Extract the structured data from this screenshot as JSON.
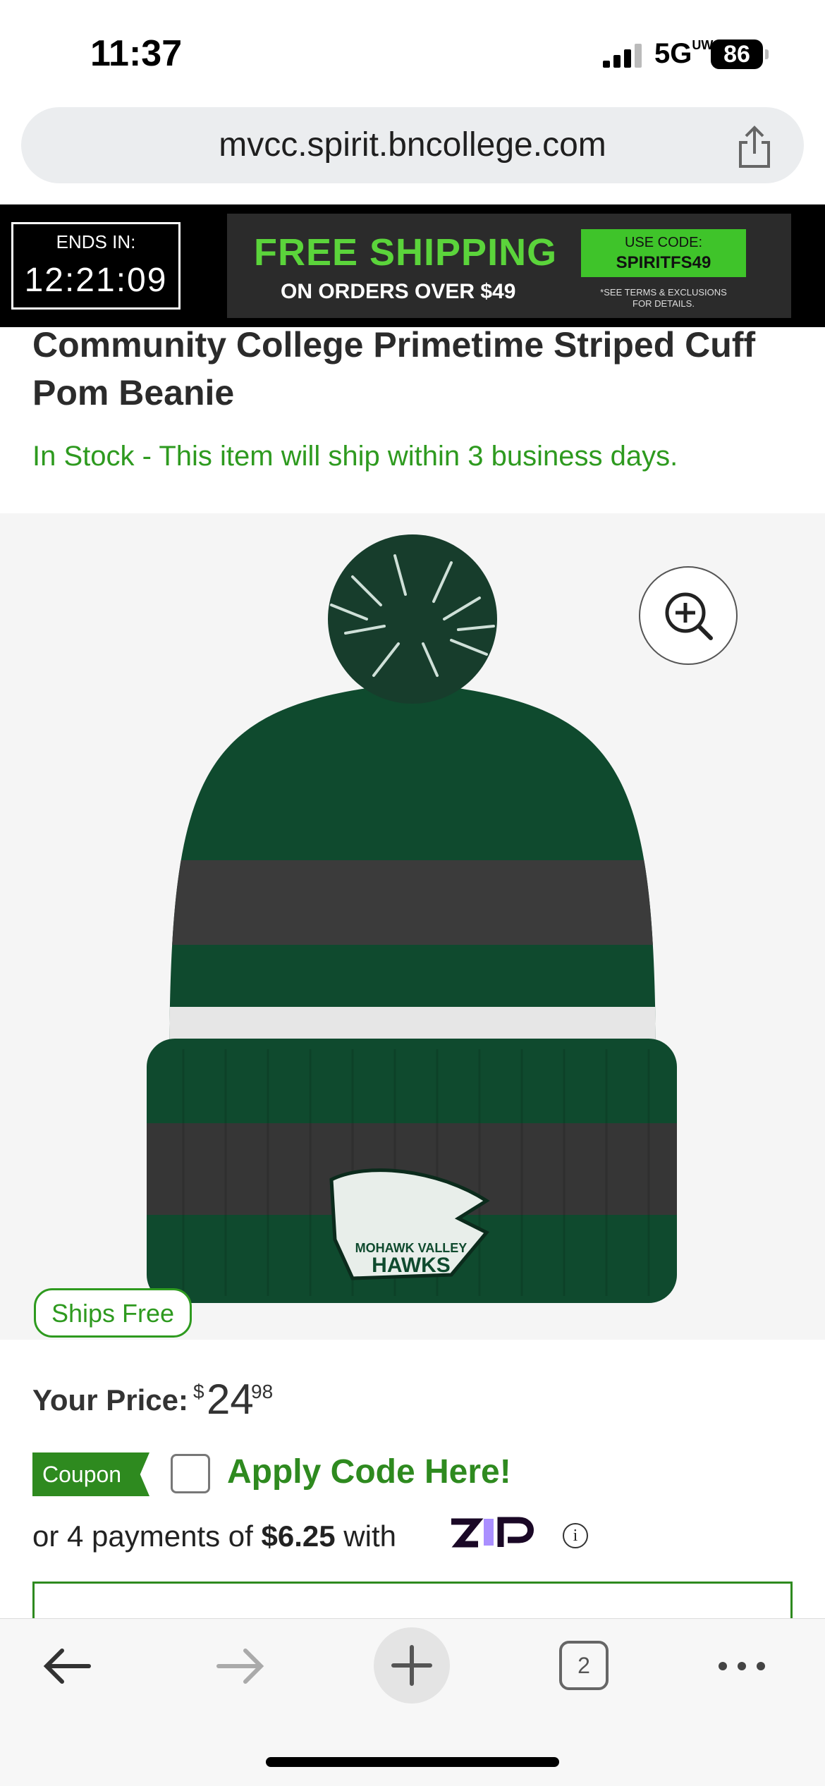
{
  "status_bar": {
    "time": "11:37",
    "network": "5G",
    "network_suffix": "UW",
    "battery": "86"
  },
  "browser": {
    "url": "mvcc.spirit.bncollege.com",
    "tab_count": "2"
  },
  "promo": {
    "timer_label": "ENDS IN:",
    "timer_value": "12:21:09",
    "headline": "FREE SHIPPING",
    "subline": "ON ORDERS OVER $49",
    "code_label": "USE CODE:",
    "code": "SPIRITFS49",
    "terms_line1": "*SEE TERMS & EXCLUSIONS",
    "terms_line2": "FOR DETAILS."
  },
  "product": {
    "title": "Community College Primetime Striped Cuff Pom Beanie",
    "stock": "In Stock - This item will ship within 3 business days.",
    "ships_free_badge": "Ships Free",
    "price_label": "Your Price:",
    "price_currency": "$",
    "price_dollars": "24",
    "price_cents": "98",
    "coupon_badge": "Coupon",
    "coupon_apply": "Apply Code Here!",
    "zip_prefix": "or 4 payments of",
    "zip_amount": "$6.25",
    "zip_suffix": "with",
    "logo_text": "MOHAWK VALLEY",
    "logo_text2": "HAWKS"
  },
  "colors": {
    "accent_green": "#2e8a1f",
    "promo_green": "#5bd43b",
    "beanie_green": "#0f4a2e",
    "beanie_gray": "#3a3a3a"
  },
  "icons": [
    "share-icon",
    "zoom-in-icon",
    "info-icon",
    "back-arrow-icon",
    "forward-arrow-icon",
    "plus-icon",
    "more-icon"
  ]
}
